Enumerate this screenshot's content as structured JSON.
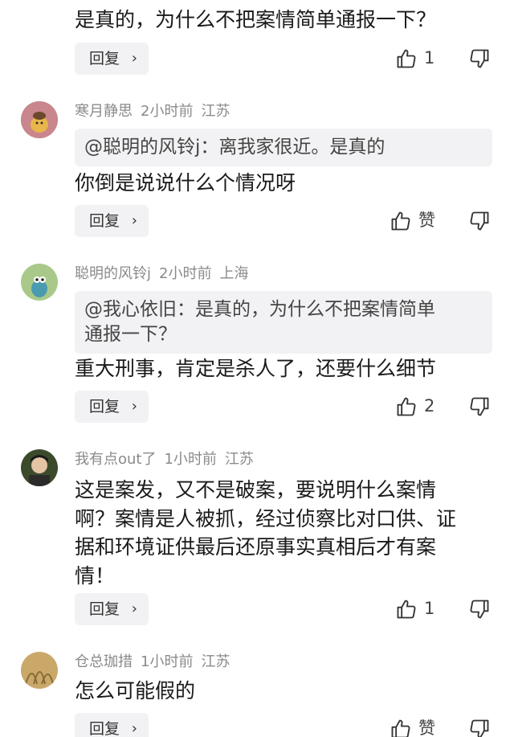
{
  "top": {
    "text": "是真的，为什么不把案情简单通报一下？",
    "like_count": "1"
  },
  "reply_label": "回复",
  "comments": [
    {
      "name": "寒月静思",
      "time": "2小时前",
      "location": "江苏",
      "quote": "@聪明的风铃j：离我家很近。是真的",
      "text": "你倒是说说什么个情况呀",
      "like_count": "赞"
    },
    {
      "name": "聪明的风铃j",
      "time": "2小时前",
      "location": "上海",
      "quote": "@我心依旧：是真的，为什么不把案情简单\n通报一下？",
      "text": "重大刑事，肯定是杀人了，还要什么细节",
      "like_count": "2"
    },
    {
      "name": "我有点out了",
      "time": "1小时前",
      "location": "江苏",
      "text": "这是案发，又不是破案，要说明什么案情\n啊？案情是人被抓，经过侦察比对口供、证\n据和环境证供最后还原事实真相后才有案\n情！",
      "like_count": "1"
    },
    {
      "name": "仓总珈措",
      "time": "1小时前",
      "location": "江苏",
      "text": "怎么可能假的",
      "like_count": "赞"
    }
  ],
  "colors": {
    "button_bg": "#f2f2f4",
    "meta_text": "#8a8a8a"
  }
}
